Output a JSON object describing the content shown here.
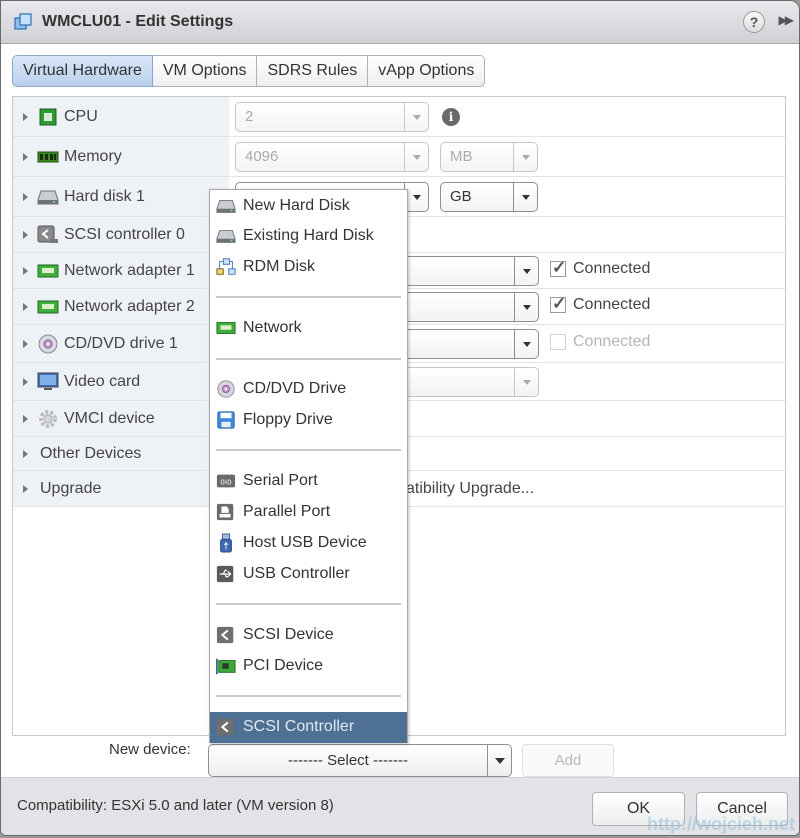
{
  "dialog": {
    "title": "WMCLU01 - Edit Settings",
    "help_label": "?",
    "expand_label": "▶▶"
  },
  "tabs": [
    {
      "label": "Virtual Hardware",
      "active": true
    },
    {
      "label": "VM Options",
      "active": false
    },
    {
      "label": "SDRS Rules",
      "active": false
    },
    {
      "label": "vApp Options",
      "active": false
    }
  ],
  "hardware": {
    "cpu": {
      "label": "CPU",
      "value": "2"
    },
    "memory": {
      "label": "Memory",
      "value": "4096",
      "unit": "MB"
    },
    "hard_disk": {
      "label": "Hard disk 1",
      "value": "",
      "unit": "GB"
    },
    "scsi": {
      "label": "SCSI controller 0"
    },
    "net1": {
      "label": "Network adapter 1",
      "connected_label": "Connected",
      "connected": true
    },
    "net2": {
      "label": "Network adapter 2",
      "connected_label": "Connected",
      "connected": true
    },
    "cddvd": {
      "label": "CD/DVD drive 1",
      "connected_label": "Connected",
      "connected": false
    },
    "video": {
      "label": "Video card"
    },
    "vmci": {
      "label": "VMCI device"
    },
    "other": {
      "label": "Other Devices"
    },
    "upgrade": {
      "label": "Upgrade",
      "value": "Schedule VM Compatibility Upgrade...",
      "visible_value": "atibility Upgrade..."
    }
  },
  "menu": {
    "items": [
      {
        "label": "New Hard Disk",
        "icon": "hard-disk-icon"
      },
      {
        "label": "Existing Hard Disk",
        "icon": "hard-disk-icon"
      },
      {
        "label": "RDM Disk",
        "icon": "rdm-disk-icon"
      },
      {
        "label": "Network",
        "icon": "network-adapter-icon"
      },
      {
        "label": "CD/DVD Drive",
        "icon": "cd-dvd-icon"
      },
      {
        "label": "Floppy Drive",
        "icon": "floppy-icon"
      },
      {
        "label": "Serial Port",
        "icon": "serial-port-icon"
      },
      {
        "label": "Parallel Port",
        "icon": "parallel-port-icon"
      },
      {
        "label": "Host USB Device",
        "icon": "usb-device-icon"
      },
      {
        "label": "USB Controller",
        "icon": "usb-controller-icon"
      },
      {
        "label": "SCSI Device",
        "icon": "scsi-icon"
      },
      {
        "label": "PCI Device",
        "icon": "pci-device-icon"
      },
      {
        "label": "SCSI Controller",
        "icon": "scsi-icon",
        "selected": true
      }
    ]
  },
  "new_device": {
    "label": "New device:",
    "select_value": "------- Select -------",
    "add_label": "Add"
  },
  "footer": {
    "compatibility": "Compatibility: ESXi 5.0 and later (VM version 8)",
    "ok_label": "OK",
    "cancel_label": "Cancel",
    "watermark": "http://wojcieh.net"
  },
  "colors": {
    "selected_menu": "#4d7093",
    "active_tab": "#c5d9f0",
    "label_column": "#eef2f7"
  }
}
